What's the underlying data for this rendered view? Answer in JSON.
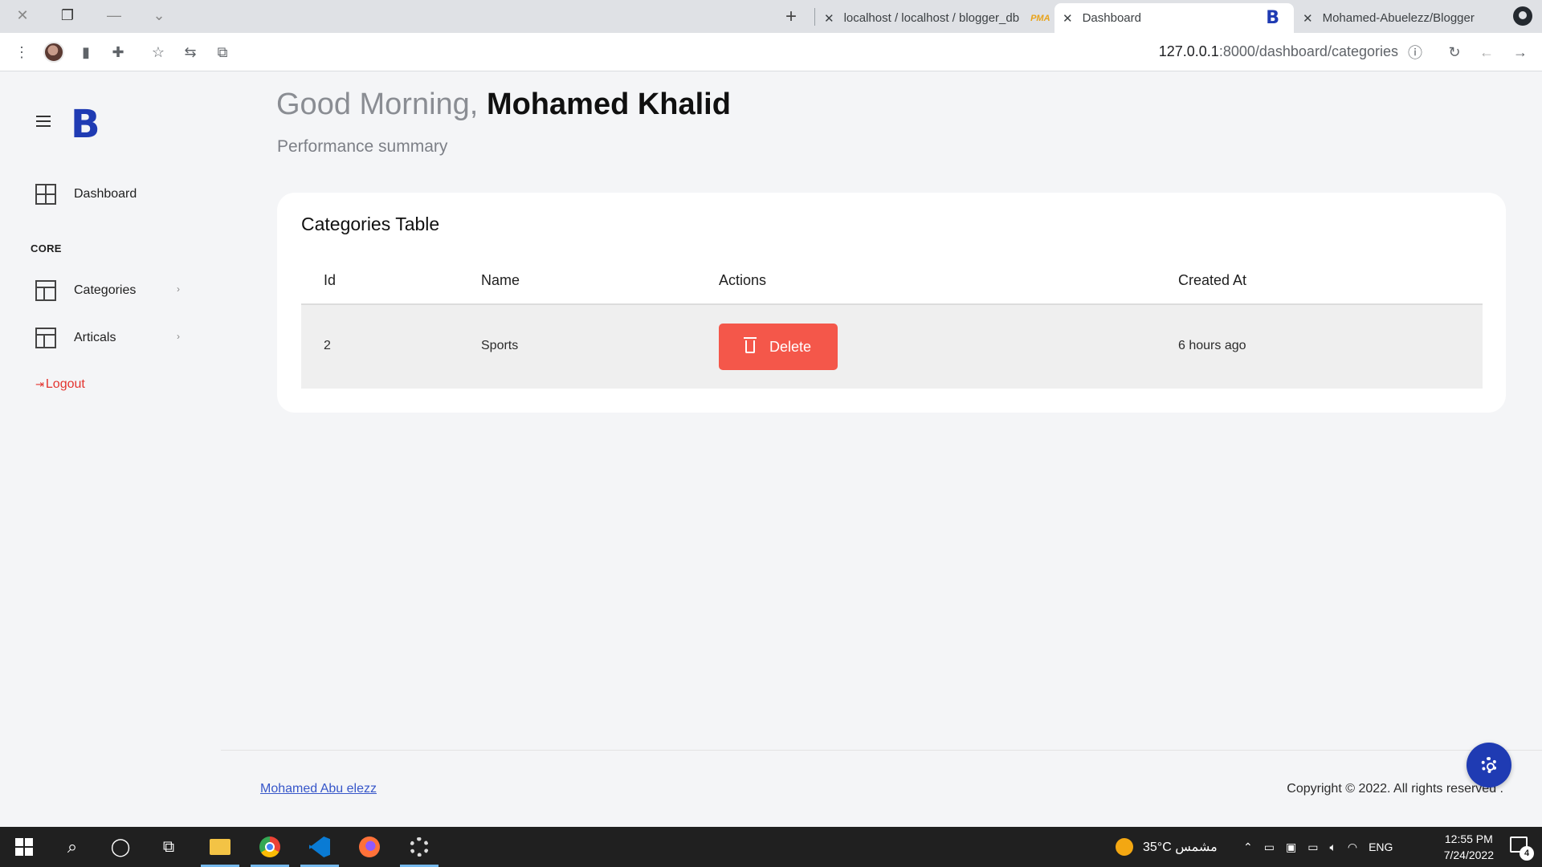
{
  "browser": {
    "tabs": [
      {
        "title": "localhost / localhost / blogger_db",
        "favicon": "phpmyadmin-icon"
      },
      {
        "title": "Dashboard",
        "favicon": "b-logo-icon",
        "active": true
      },
      {
        "title": "Mohamed-Abuelezz/Blogger",
        "favicon": "github-icon"
      }
    ],
    "url": {
      "host": "127.0.0.1",
      "rest": ":8000/dashboard/categories"
    }
  },
  "sidebar": {
    "logo": "B",
    "items": [
      {
        "label": "Dashboard",
        "icon": "grid-icon"
      },
      {
        "label": "Categories",
        "icon": "layout-icon"
      },
      {
        "label": "Articals",
        "icon": "layout-icon"
      }
    ],
    "section": "CORE",
    "logout": "Logout"
  },
  "header": {
    "greeting": "Good Morning,",
    "name": "Mohamed Khalid",
    "subtitle": "Performance summary"
  },
  "table": {
    "title": "Categories Table",
    "columns": [
      "Id",
      "Name",
      "Actions",
      "Created At"
    ],
    "rows": [
      {
        "id": "2",
        "name": "Sports",
        "action": "Delete",
        "created_at": "6 hours ago"
      }
    ]
  },
  "footer": {
    "author": "Mohamed Abu elezz",
    "copyright": "Copyright © 2022. All rights reserved ."
  },
  "taskbar": {
    "weather": "35°C  مشمس",
    "lang": "ENG",
    "time": "12:55 PM",
    "date": "7/24/2022",
    "notifications": "4"
  },
  "colors": {
    "brand": "#1f3bb3",
    "danger": "#f4574a",
    "logout": "#e3342f"
  }
}
